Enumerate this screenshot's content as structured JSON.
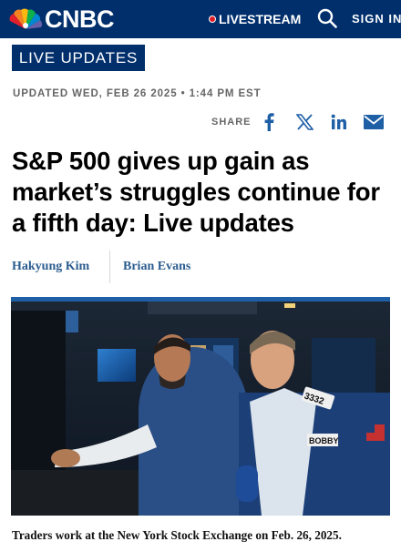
{
  "header": {
    "brand": "CNBC",
    "livestream_label": "LIVESTREAM",
    "signin_label": "SIGN IN",
    "icons": [
      "peacock-logo-icon",
      "live-dot-icon",
      "search-icon"
    ],
    "colors": {
      "navy": "#002f6c",
      "live_red": "#e01a22"
    }
  },
  "article": {
    "badge": "LIVE UPDATES",
    "updated": "UPDATED WED, FEB 26 2025 • 1:44 PM EST",
    "share": {
      "label": "SHARE",
      "icons": [
        "facebook-icon",
        "x-icon",
        "linkedin-icon",
        "email-icon"
      ]
    },
    "headline": "S&P 500 gives up gain as market’s struggles continue for a fifth day: Live updates",
    "authors": [
      "Hakyung Kim",
      "Brian Evans"
    ],
    "photo": {
      "caption": "Traders work at the New York Stock Exchange on Feb. 26, 2025.",
      "badge_number": "3332",
      "name_tag": "BOBBY"
    }
  }
}
